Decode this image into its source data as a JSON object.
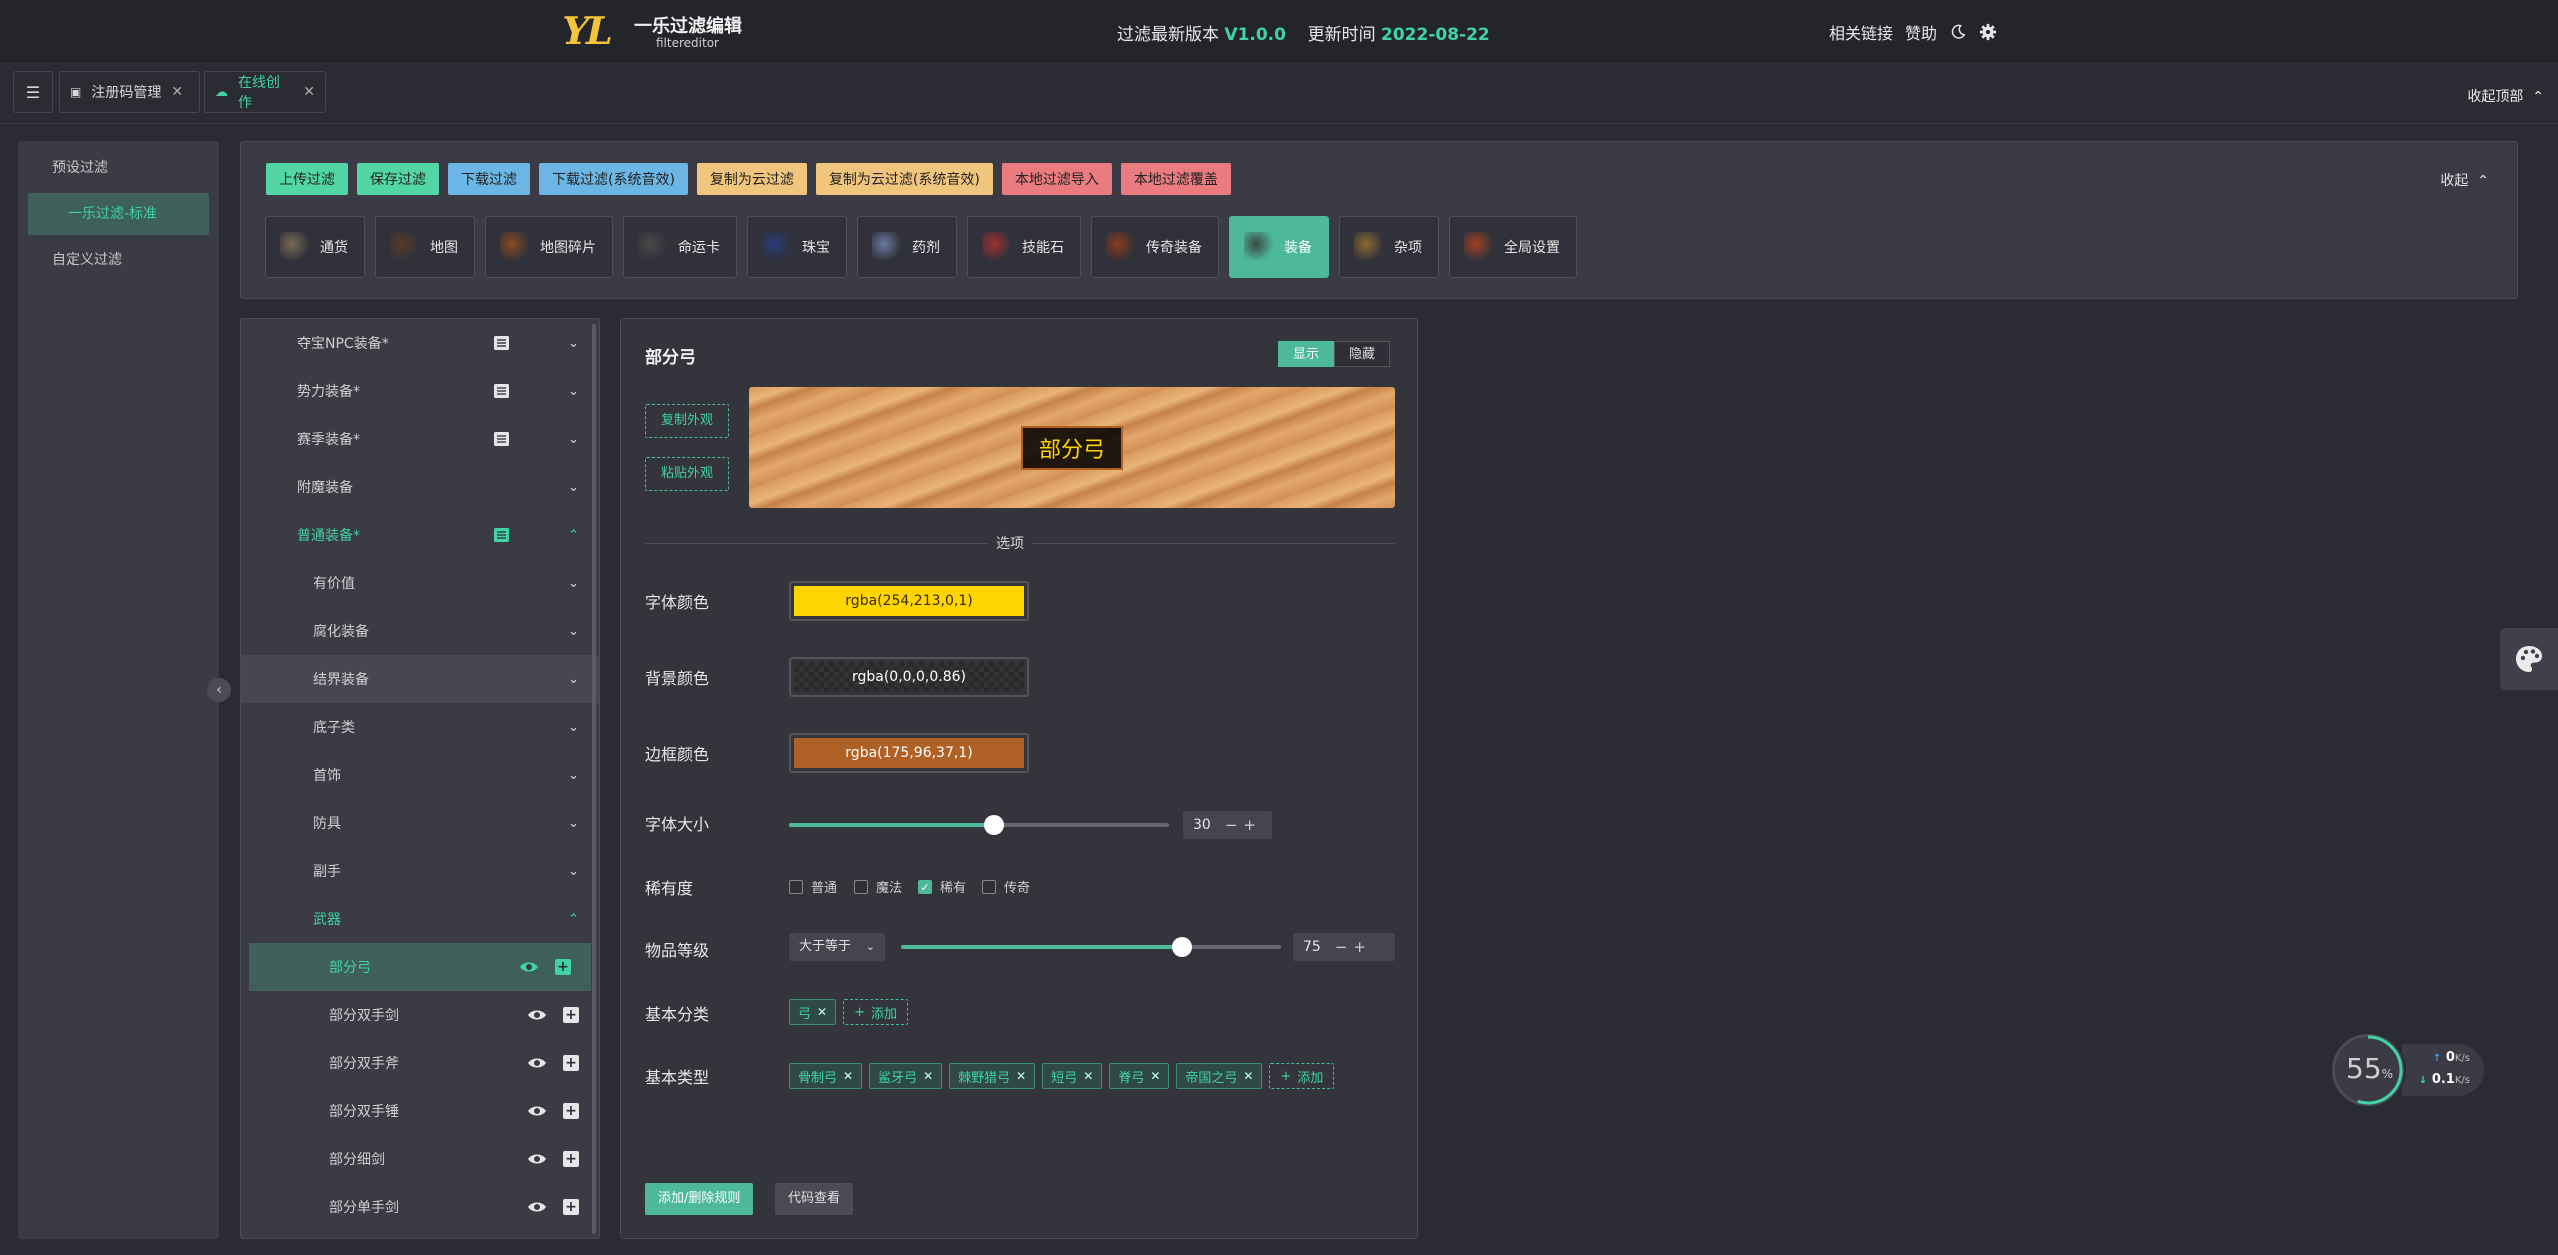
{
  "header": {
    "logo_mark": "YL",
    "title": "一乐过滤编辑",
    "subtitle": "filtereditor",
    "version_label": "过滤最新版本",
    "version": "V1.0.0",
    "update_label": "更新时间",
    "update_date": "2022-08-22",
    "links_label": "相关链接",
    "sponsor_label": "赞助"
  },
  "tabs": [
    {
      "label": "注册码管理"
    },
    {
      "label": "在线创作"
    }
  ],
  "collapse_top_label": "收起顶部",
  "sidebar": {
    "items": [
      {
        "label": "预设过滤"
      },
      {
        "label": "一乐过滤-标准"
      },
      {
        "label": "自定义过滤"
      }
    ]
  },
  "toolbar": {
    "buttons": [
      {
        "label": "上传过滤",
        "color": "#52d6a6"
      },
      {
        "label": "保存过滤",
        "color": "#52d6a6"
      },
      {
        "label": "下载过滤",
        "color": "#6cb6e6"
      },
      {
        "label": "下载过滤(系统音效)",
        "color": "#6cb6e6"
      },
      {
        "label": "复制为云过滤",
        "color": "#f2c57d"
      },
      {
        "label": "复制为云过滤(系统音效)",
        "color": "#f2c57d"
      },
      {
        "label": "本地过滤导入",
        "color": "#ea7b7f"
      },
      {
        "label": "本地过滤覆盖",
        "color": "#ea7b7f"
      }
    ],
    "collapse_label": "收起"
  },
  "categories": [
    {
      "label": "通货",
      "icon": "currency-icon"
    },
    {
      "label": "地图",
      "icon": "map-icon"
    },
    {
      "label": "地图碎片",
      "icon": "map-fragment-icon"
    },
    {
      "label": "命运卡",
      "icon": "divination-card-icon"
    },
    {
      "label": "珠宝",
      "icon": "jewel-icon"
    },
    {
      "label": "药剂",
      "icon": "flask-icon"
    },
    {
      "label": "技能石",
      "icon": "gem-icon"
    },
    {
      "label": "传奇装备",
      "icon": "unique-item-icon"
    },
    {
      "label": "装备",
      "icon": "equipment-icon",
      "active": true
    },
    {
      "label": "杂项",
      "icon": "misc-icon"
    },
    {
      "label": "全局设置",
      "icon": "global-settings-icon"
    }
  ],
  "tree": {
    "items": [
      {
        "label": "夺宝NPC装备*",
        "level": 1,
        "has_list": true
      },
      {
        "label": "势力装备*",
        "level": 1,
        "has_list": true
      },
      {
        "label": "赛季装备*",
        "level": 1,
        "has_list": true
      },
      {
        "label": "附魔装备",
        "level": 1
      },
      {
        "label": "普通装备*",
        "level": 1,
        "has_list": true,
        "open": true
      },
      {
        "label": "有价值",
        "level": 2
      },
      {
        "label": "腐化装备",
        "level": 2
      },
      {
        "label": "结界装备",
        "level": 2
      },
      {
        "label": "底子类",
        "level": 2
      },
      {
        "label": "首饰",
        "level": 2
      },
      {
        "label": "防具",
        "level": 2
      },
      {
        "label": "副手",
        "level": 2
      },
      {
        "label": "武器",
        "level": 2,
        "open": true
      },
      {
        "label": "部分弓",
        "level": 3,
        "leaf": true
      },
      {
        "label": "部分双手剑",
        "level": 3,
        "leaf": true
      },
      {
        "label": "部分双手斧",
        "level": 3,
        "leaf": true
      },
      {
        "label": "部分双手锤",
        "level": 3,
        "leaf": true
      },
      {
        "label": "部分细剑",
        "level": 3,
        "leaf": true
      },
      {
        "label": "部分单手剑",
        "level": 3,
        "leaf": true
      }
    ]
  },
  "editor": {
    "title": "部分弓",
    "show_label": "显示",
    "hide_label": "隐藏",
    "copy_style_label": "复制外观",
    "paste_style_label": "粘贴外观",
    "preview_text": "部分弓",
    "options_label": "选项",
    "font_color_label": "字体颜色",
    "font_color": "rgba(254,213,0,1)",
    "bg_color_label": "背景颜色",
    "bg_color": "rgba(0,0,0,0.86)",
    "border_color_label": "边框颜色",
    "border_color": "rgba(175,96,37,1)",
    "font_size_label": "字体大小",
    "font_size": "30",
    "font_size_fraction": 0.54,
    "rarity_label": "稀有度",
    "rarities": [
      {
        "label": "普通",
        "checked": false
      },
      {
        "label": "魔法",
        "checked": false
      },
      {
        "label": "稀有",
        "checked": true
      },
      {
        "label": "传奇",
        "checked": false
      }
    ],
    "item_level_label": "物品等级",
    "item_level_op": "大于等于",
    "item_level": "75",
    "item_level_fraction": 0.74,
    "base_class_label": "基本分类",
    "base_classes": [
      "弓"
    ],
    "add_label": "添加",
    "base_type_label": "基本类型",
    "base_types": [
      "骨制弓",
      "鲨牙弓",
      "棘野猎弓",
      "短弓",
      "脊弓",
      "帝国之弓"
    ],
    "add_remove_rule_label": "添加/删除规则",
    "view_code_label": "代码查看"
  },
  "network": {
    "percent": "55",
    "percent_unit": "%",
    "up": "0",
    "down": "0.1",
    "unit": "K/s"
  }
}
